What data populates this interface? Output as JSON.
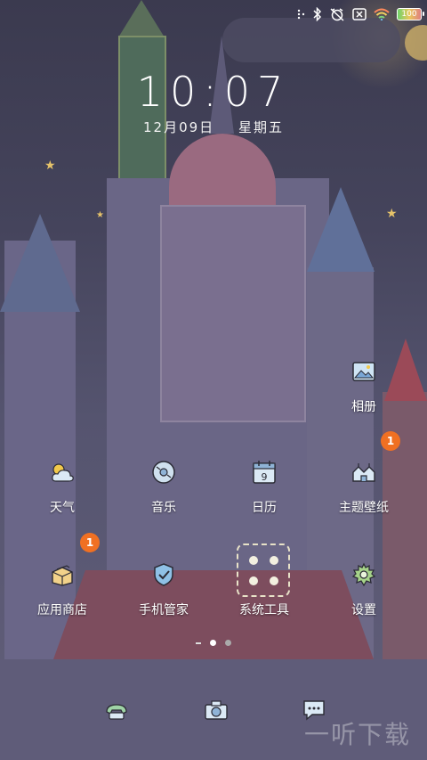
{
  "status": {
    "battery": "100"
  },
  "clock": {
    "time": "10:07",
    "date": "12月09日",
    "weekday": "星期五"
  },
  "apps": {
    "gallery": "相册",
    "weather": "天气",
    "music": "音乐",
    "calendar": "日历",
    "calendar_day": "9",
    "theme": "主题壁纸",
    "theme_badge": "1",
    "store": "应用商店",
    "store_badge": "1",
    "security": "手机管家",
    "tools": "系统工具",
    "settings": "设置"
  },
  "watermark": "一听下载"
}
